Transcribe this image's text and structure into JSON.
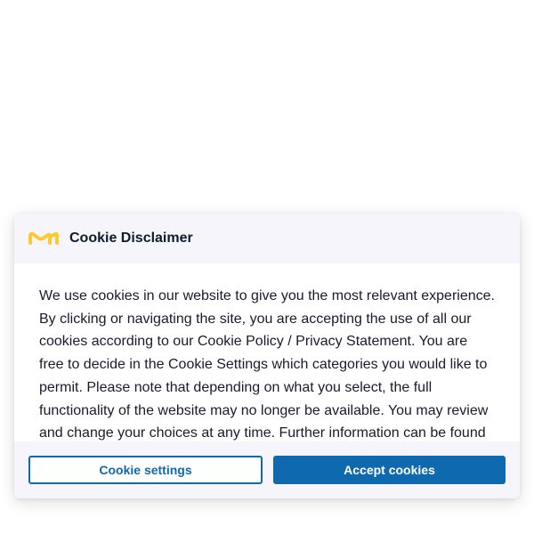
{
  "dialog": {
    "title": "Cookie Disclaimer",
    "logo_icon": "merck-m-logo-icon",
    "body_text": "We use cookies in our website to give you the most relevant experience. By clicking or navigating the site, you are accepting the use of all our cookies according to our Cookie Policy / Privacy Statement. You are free to decide in the Cookie Settings which categories you would like to permit. Please note that depending on what you select, the full functionality of the website may no longer be available. You may review and change your choices at any time. Further information can be found in",
    "buttons": {
      "settings_label": "Cookie settings",
      "accept_label": "Accept cookies"
    }
  },
  "colors": {
    "accent": "#0f69af",
    "header_bg": "#f5f5fb",
    "logo": "#ffc832"
  }
}
